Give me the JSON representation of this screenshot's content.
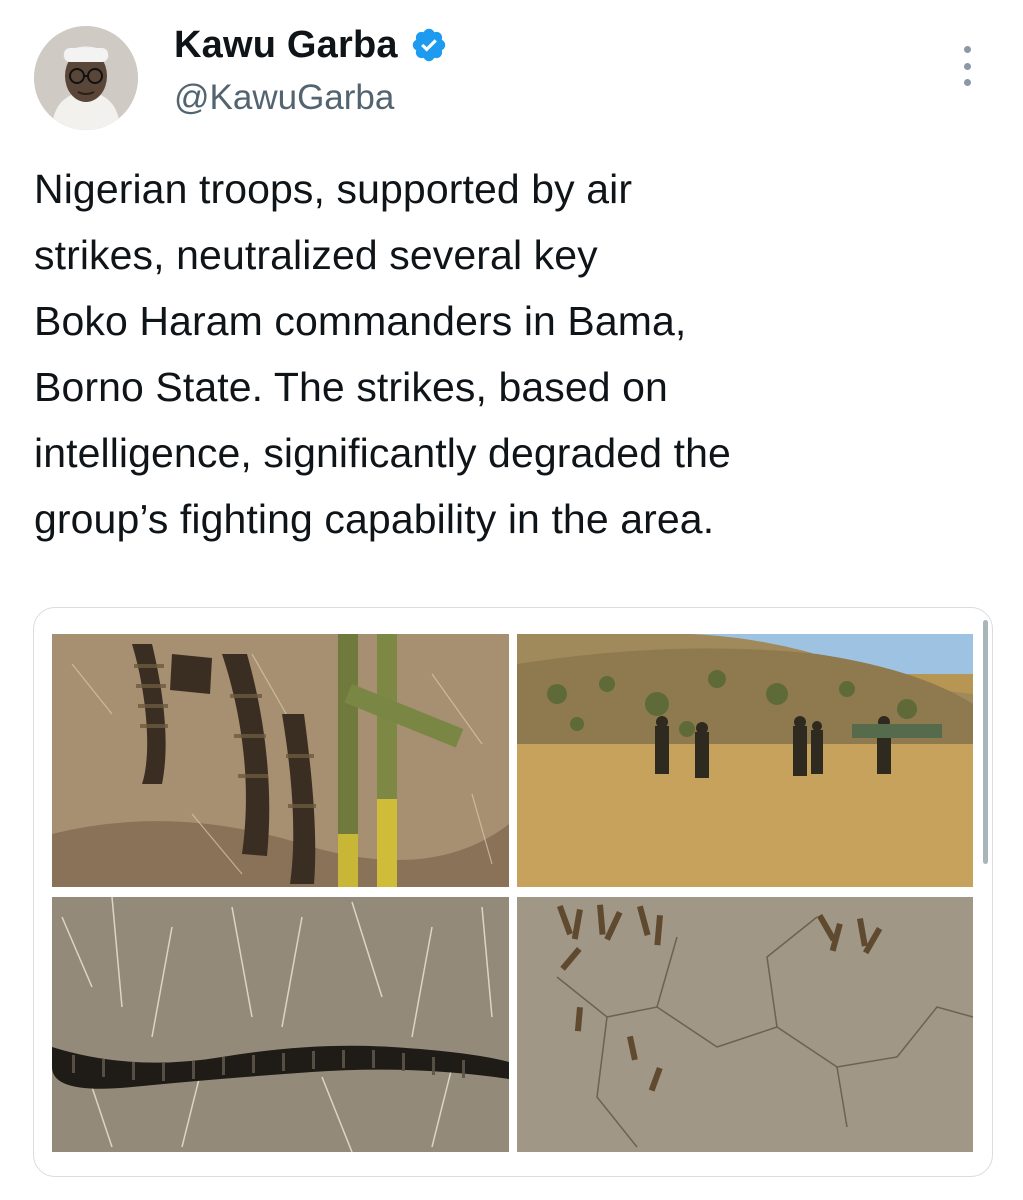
{
  "author": {
    "display_name": "Kawu Garba",
    "handle": "@KawuGarba",
    "verified": true,
    "verified_color": "#1d9bf0"
  },
  "tweet": {
    "lines": [
      "Nigerian troops, supported by air",
      "strikes, neutralized several key",
      "Boko Haram commanders in Bama,",
      "Borno State. The strikes, based on",
      "intelligence, significantly degraded the",
      "group’s fighting capability in the area."
    ]
  },
  "icons": {
    "more": "more-options-icon",
    "verified": "verified-badge-icon"
  }
}
